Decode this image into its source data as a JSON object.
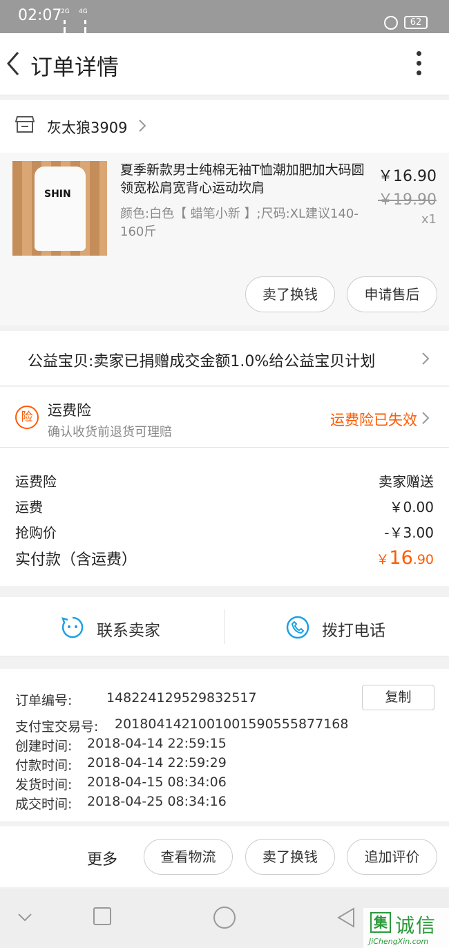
{
  "status_bar": {
    "time": "02:07",
    "net1": "2G",
    "net2": "4G",
    "battery": "62"
  },
  "header": {
    "title": "订单详情"
  },
  "shop": {
    "name": "灰太狼3909"
  },
  "item": {
    "title": "夏季新款男士纯棉无袖T恤潮加肥加大码圆领宽松肩宽背心运动坎肩",
    "sku": "颜色:白色【 蜡笔小新 】;尺码:XL建议140-160斤",
    "price": "￥16.90",
    "original_price": "￥19.90",
    "quantity": "x1",
    "thumb_logo": "SHIN",
    "buttons": {
      "sell": "卖了换钱",
      "after_sale": "申请售后"
    }
  },
  "charity": {
    "text": "公益宝贝:卖家已捐赠成交金额1.0%给公益宝贝计划"
  },
  "insurance": {
    "badge": "险",
    "title": "运费险",
    "subtitle": "确认收货前退货可理赔",
    "status": "运费险已失效",
    "status_color": "#ff5a00"
  },
  "fees": {
    "rows": [
      {
        "label": "运费险",
        "value": "卖家赠送"
      },
      {
        "label": "运费",
        "value": "￥0.00"
      },
      {
        "label": "抢购价",
        "value": "-￥3.00"
      }
    ],
    "total": {
      "label": "实付款（含运费）",
      "currency": "￥",
      "integer": "16",
      "decimal": ".90"
    }
  },
  "contact": {
    "seller": "联系卖家",
    "phone": "拨打电话"
  },
  "order_info": {
    "order_no": {
      "label": "订单编号:",
      "value": "148224129529832517"
    },
    "alipay_no": {
      "label": "支付宝交易号:",
      "value": "2018041421001001590555877168"
    },
    "created": {
      "label": "创建时间:",
      "value": "2018-04-14 22:59:15"
    },
    "paid": {
      "label": "付款时间:",
      "value": "2018-04-14 22:59:29"
    },
    "shipped": {
      "label": "发货时间:",
      "value": "2018-04-15 08:34:06"
    },
    "completed": {
      "label": "成交时间:",
      "value": "2018-04-25 08:34:16"
    },
    "copy_label": "复制"
  },
  "actions": {
    "more": "更多",
    "logistics": "查看物流",
    "sell": "卖了换钱",
    "review": "追加评价"
  },
  "watermark": {
    "box_char": "集",
    "name": "诚信",
    "url": "JiChengXin.com"
  },
  "colors": {
    "accent": "#ff5a00",
    "icon_blue": "#1aa0e6"
  }
}
